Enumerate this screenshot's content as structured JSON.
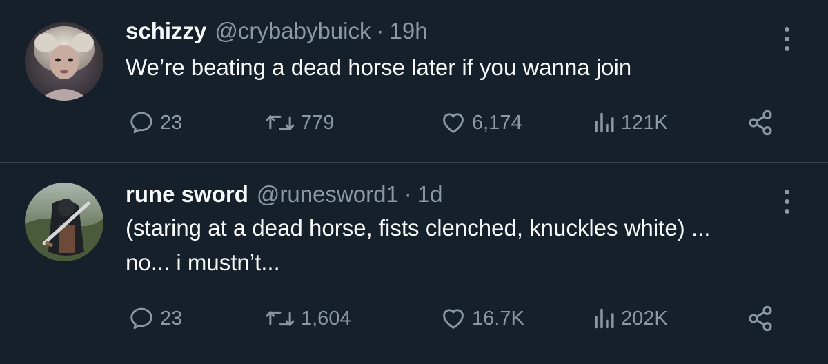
{
  "tweets": [
    {
      "display_name": "schizzy",
      "handle": "@crybabybuick",
      "separator": "·",
      "time": "19h",
      "text": "We’re beating a dead horse later if you wanna join",
      "replies": "23",
      "retweets": "779",
      "likes": "6,174",
      "views": "121K"
    },
    {
      "display_name": "rune sword",
      "handle": "@runesword1",
      "separator": "·",
      "time": "1d",
      "text": "(staring at a dead horse, fists clenched, knuckles white) ...\nno... i mustn’t...",
      "replies": "23",
      "retweets": "1,604",
      "likes": "16.7K",
      "views": "202K"
    }
  ],
  "icons": {
    "reply": "reply-icon",
    "retweet": "retweet-icon",
    "like": "heart-icon",
    "views": "views-icon",
    "share": "share-icon",
    "more": "more-options-icon"
  },
  "colors": {
    "background": "#15202b",
    "primary_text": "#f7f9f9",
    "secondary_text": "#8b98a5",
    "divider": "#38444d"
  }
}
